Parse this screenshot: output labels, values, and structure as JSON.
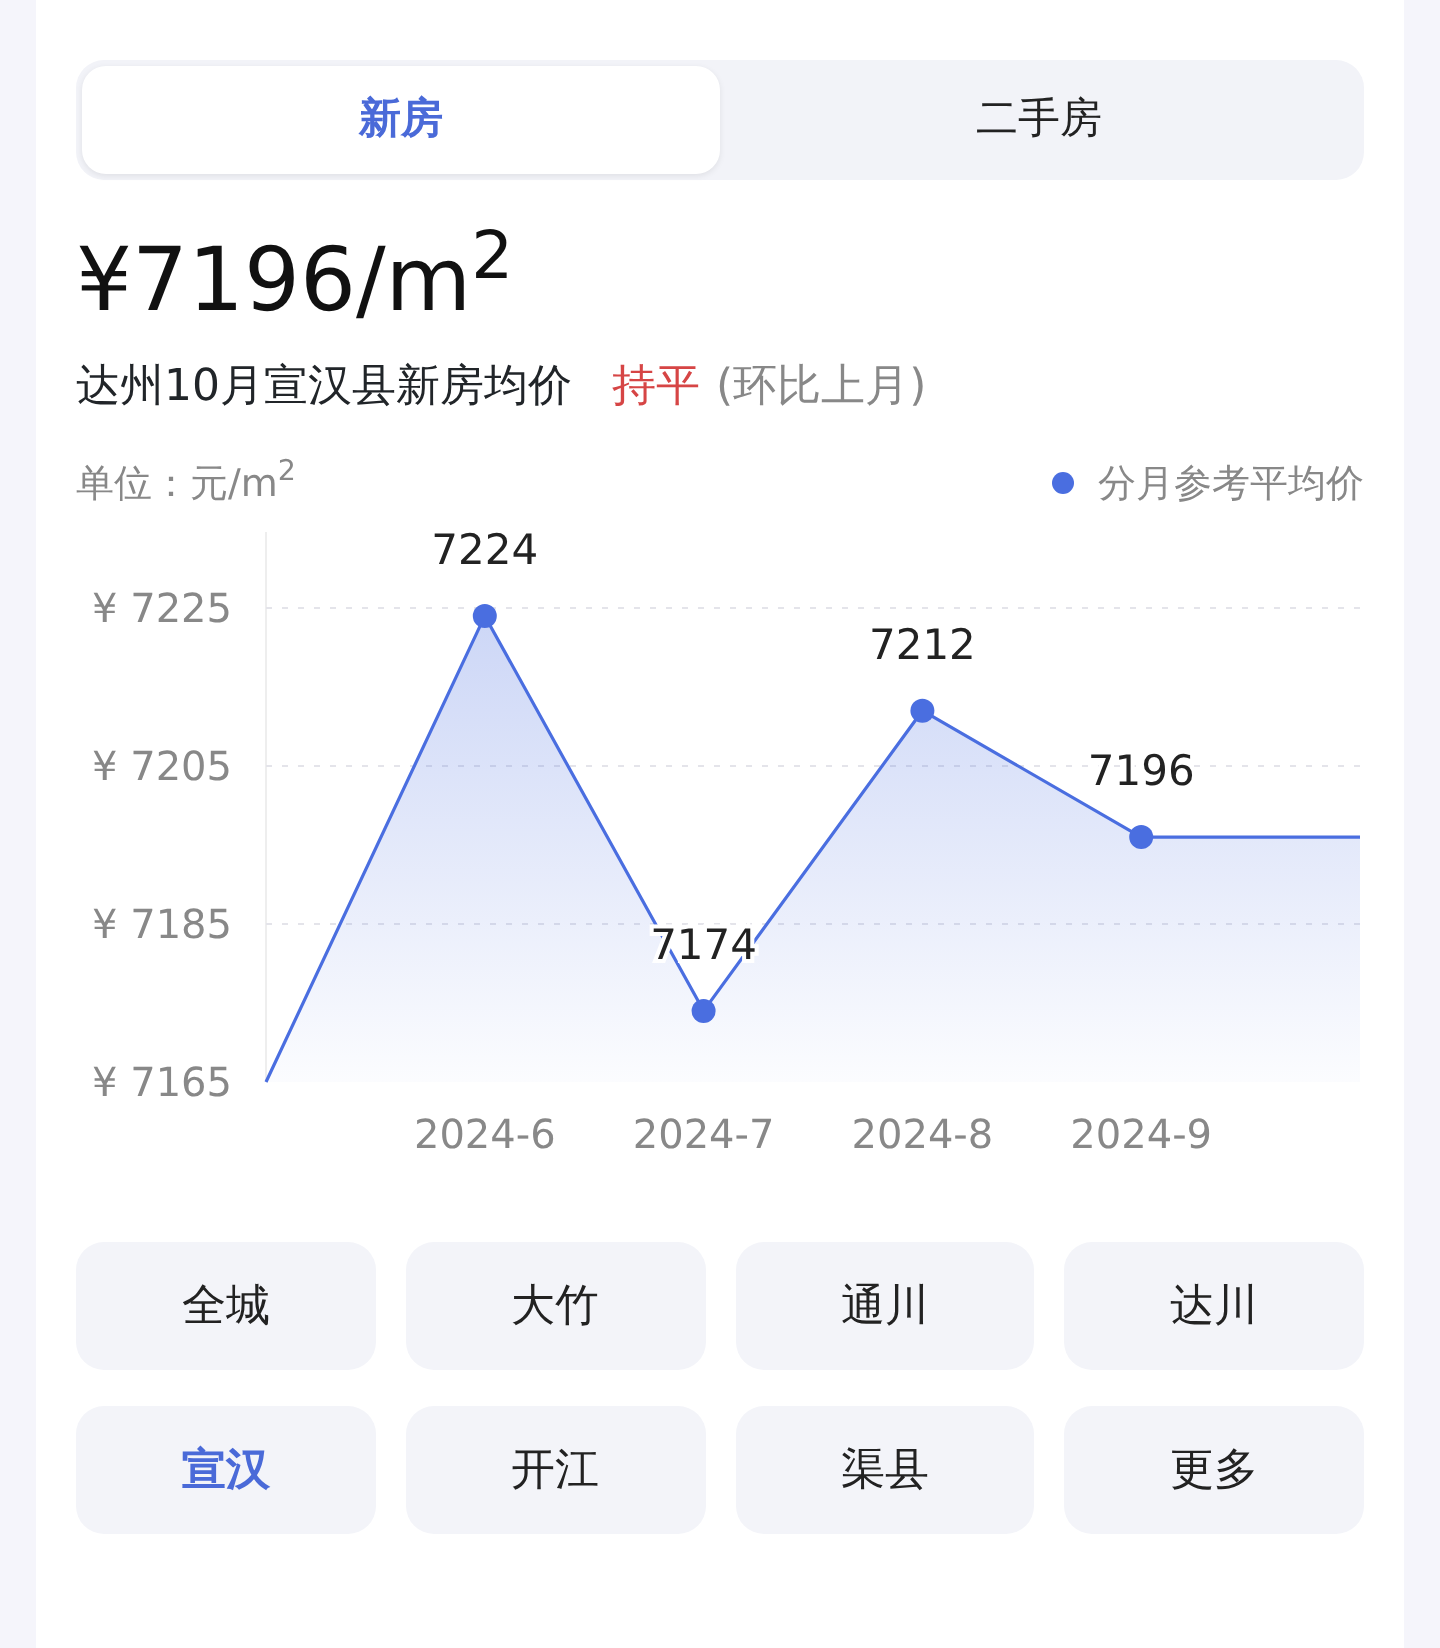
{
  "tabs": [
    {
      "label": "新房",
      "selected": true
    },
    {
      "label": "二手房",
      "selected": false
    }
  ],
  "price": {
    "text": "¥7196/m$^{2}$"
  },
  "subtitle": {
    "title": "达州10月宣汉县新房均价",
    "trend": "持平",
    "note": "(环比上月)"
  },
  "unit": "单位：元/m$^{2}$",
  "chart_data": {
    "type": "area",
    "categories": [
      null,
      "2024-6",
      "2024-7",
      "2024-8",
      "2024-9",
      null
    ],
    "ylim": [
      7165,
      7225
    ],
    "yticks": [
      {
        "value": 7225,
        "label": "¥ 7225"
      },
      {
        "value": 7205,
        "label": "¥ 7205"
      },
      {
        "value": 7185,
        "label": "¥ 7185"
      },
      {
        "value": 7165,
        "label": "¥ 7165"
      }
    ],
    "series": [
      {
        "name": "分月参考平均价",
        "color": "#4a6ee0",
        "values": [
          7165,
          7224,
          7174,
          7212,
          7196,
          7196
        ]
      }
    ],
    "value_labels": [
      null,
      "7224",
      "7174",
      "7212",
      "7196",
      null
    ]
  },
  "districts": [
    {
      "label": "全城",
      "selected": false
    },
    {
      "label": "大竹",
      "selected": false
    },
    {
      "label": "通川",
      "selected": false
    },
    {
      "label": "达川",
      "selected": false
    },
    {
      "label": "宣汉",
      "selected": true
    },
    {
      "label": "开江",
      "selected": false
    },
    {
      "label": "渠县",
      "selected": false
    },
    {
      "label": "更多",
      "selected": false
    }
  ]
}
